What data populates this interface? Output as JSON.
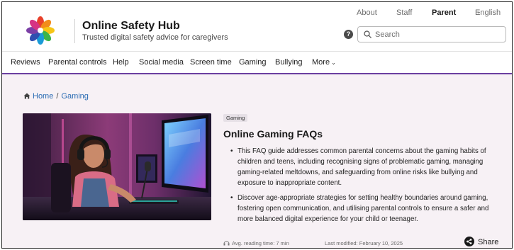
{
  "brand": {
    "title": "Online Safety Hub",
    "subtitle": "Trusted digital safety advice for caregivers"
  },
  "top_links": {
    "about": "About",
    "staff": "Staff",
    "parent": "Parent",
    "language": "English"
  },
  "search": {
    "placeholder": "Search"
  },
  "help_icon": "?",
  "nav": {
    "items": [
      "Reviews",
      "Parental controls",
      "Help",
      "Social media",
      "Screen time",
      "Gaming",
      "Bullying",
      "More"
    ]
  },
  "breadcrumb": {
    "home": "Home",
    "separator": "/",
    "current": "Gaming"
  },
  "article": {
    "tag": "Gaming",
    "title": "Online Gaming FAQs",
    "bullets": [
      "This FAQ guide addresses common parental concerns about the gaming habits of children and teens, including recognising signs of problematic gaming, managing gaming-related meltdowns, and safeguarding from online risks like bullying and exposure to inappropriate content.",
      "Discover age-appropriate strategies for setting healthy boundaries around gaming, fostering open communication, and utilising parental controls to ensure a safer and more balanced digital experience for your child or teenager."
    ],
    "reading_time": "Avg. reading time: 7 min",
    "last_modified": "Last modified: February 10, 2025",
    "share": "Share"
  },
  "colors": {
    "accent_purple": "#6b3fa0",
    "link_blue": "#2a6bb3",
    "background_tint": "#f7f1f5"
  },
  "icons": [
    "logo-flower-icon",
    "help-icon",
    "search-icon",
    "chevron-down-icon",
    "home-icon",
    "headphones-icon",
    "share-icon"
  ]
}
